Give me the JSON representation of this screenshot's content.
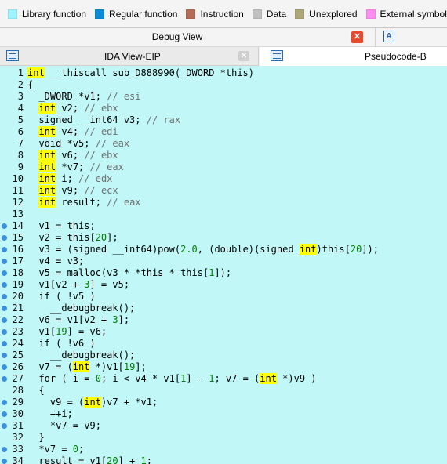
{
  "legend": {
    "items": [
      {
        "label": "Library function",
        "color": "#9ff3ff"
      },
      {
        "label": "Regular function",
        "color": "#0b8ad6"
      },
      {
        "label": "Instruction",
        "color": "#b46e57"
      },
      {
        "label": "Data",
        "color": "#c0c0c0"
      },
      {
        "label": "Unexplored",
        "color": "#aca67a"
      },
      {
        "label": "External symbol",
        "color": "#ff8cf0"
      }
    ]
  },
  "debug_view": {
    "title": "Debug View",
    "close_glyph": "✕",
    "a_icon": "A"
  },
  "tabs": {
    "ida_view": {
      "label": "IDA View-EIP",
      "icon": "listing-icon",
      "close_glyph": "✕"
    },
    "pseudocode": {
      "label": "Pseudocode-B",
      "icon": "listing-icon"
    }
  },
  "code": {
    "background": "#c2f7f7",
    "highlight": "#ffff00",
    "lines": [
      {
        "n": "1",
        "bp": false,
        "text": "int __thiscall sub_D888990(_DWORD *this)"
      },
      {
        "n": "2",
        "bp": false,
        "text": "{"
      },
      {
        "n": "3",
        "bp": false,
        "text": "  _DWORD *v1; // esi"
      },
      {
        "n": "4",
        "bp": false,
        "text": "  int v2; // ebx"
      },
      {
        "n": "5",
        "bp": false,
        "text": "  signed __int64 v3; // rax"
      },
      {
        "n": "6",
        "bp": false,
        "text": "  int v4; // edi"
      },
      {
        "n": "7",
        "bp": false,
        "text": "  void *v5; // eax"
      },
      {
        "n": "8",
        "bp": false,
        "text": "  int v6; // ebx"
      },
      {
        "n": "9",
        "bp": false,
        "text": "  int *v7; // eax"
      },
      {
        "n": "10",
        "bp": false,
        "text": "  int i; // edx"
      },
      {
        "n": "11",
        "bp": false,
        "text": "  int v9; // ecx"
      },
      {
        "n": "12",
        "bp": false,
        "text": "  int result; // eax"
      },
      {
        "n": "13",
        "bp": false,
        "text": ""
      },
      {
        "n": "14",
        "bp": true,
        "text": "  v1 = this;"
      },
      {
        "n": "15",
        "bp": true,
        "text": "  v2 = this[20];"
      },
      {
        "n": "16",
        "bp": true,
        "text": "  v3 = (signed __int64)pow(2.0, (double)(signed int)this[20]);"
      },
      {
        "n": "17",
        "bp": true,
        "text": "  v4 = v3;"
      },
      {
        "n": "18",
        "bp": true,
        "text": "  v5 = malloc(v3 * *this * this[1]);"
      },
      {
        "n": "19",
        "bp": true,
        "text": "  v1[v2 + 3] = v5;"
      },
      {
        "n": "20",
        "bp": true,
        "text": "  if ( !v5 )"
      },
      {
        "n": "21",
        "bp": true,
        "text": "    __debugbreak();"
      },
      {
        "n": "22",
        "bp": true,
        "text": "  v6 = v1[v2 + 3];"
      },
      {
        "n": "23",
        "bp": true,
        "text": "  v1[19] = v6;"
      },
      {
        "n": "24",
        "bp": true,
        "text": "  if ( !v6 )"
      },
      {
        "n": "25",
        "bp": true,
        "text": "    __debugbreak();"
      },
      {
        "n": "26",
        "bp": true,
        "text": "  v7 = (int *)v1[19];"
      },
      {
        "n": "27",
        "bp": true,
        "text": "  for ( i = 0; i < v4 * v1[1] - 1; v7 = (int *)v9 )"
      },
      {
        "n": "28",
        "bp": false,
        "text": "  {"
      },
      {
        "n": "29",
        "bp": true,
        "text": "    v9 = (int)v7 + *v1;"
      },
      {
        "n": "30",
        "bp": true,
        "text": "    ++i;"
      },
      {
        "n": "31",
        "bp": true,
        "text": "    *v7 = v9;"
      },
      {
        "n": "32",
        "bp": false,
        "text": "  }"
      },
      {
        "n": "33",
        "bp": true,
        "text": "  *v7 = 0;"
      },
      {
        "n": "34",
        "bp": true,
        "text": "  result = v1[20] + 1;"
      }
    ]
  }
}
